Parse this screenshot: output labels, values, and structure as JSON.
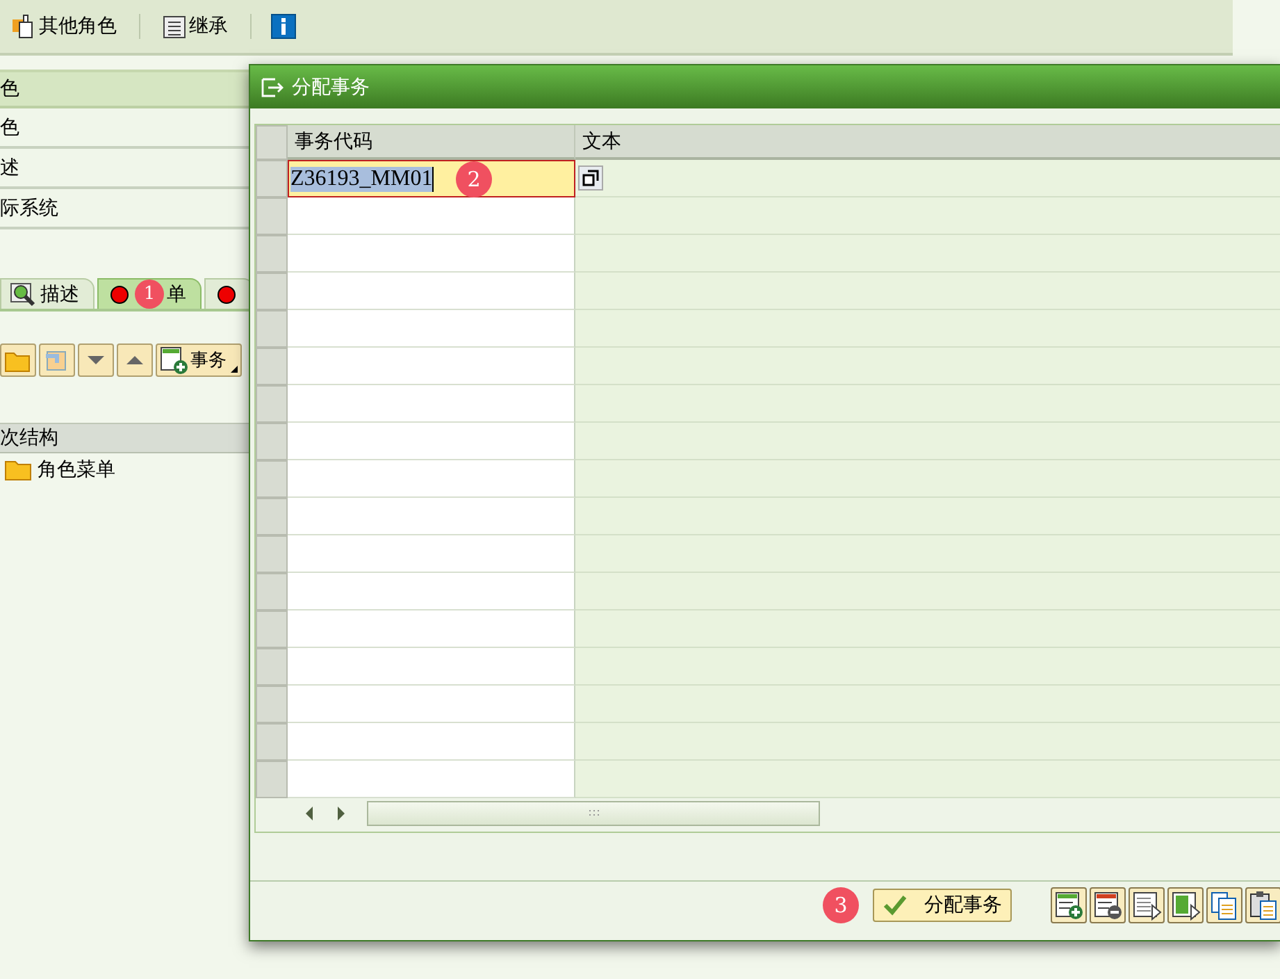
{
  "toolbar": {
    "items": [
      {
        "kind": "roles",
        "label": "其他角色"
      },
      {
        "kind": "inherit",
        "label": "继承"
      },
      {
        "kind": "info"
      }
    ]
  },
  "form": {
    "header": "色",
    "rows": [
      "色",
      "述",
      "际系统"
    ]
  },
  "tabs": [
    {
      "kind": "describe",
      "label": "描述",
      "selected": false
    },
    {
      "kind": "menu",
      "label": "单",
      "selected": true,
      "badge": "1"
    },
    {
      "kind": "menu",
      "selected": false
    }
  ],
  "menu_toolbar": {
    "buttons": [
      {
        "kind": "folder"
      },
      {
        "kind": "undo"
      },
      {
        "kind": "down"
      },
      {
        "kind": "up"
      },
      {
        "kind": "add",
        "label": "事务"
      }
    ]
  },
  "hierarchy": {
    "header": "次结构",
    "tree": [
      {
        "label": "角色菜单"
      }
    ]
  },
  "dialog": {
    "title": "分配事务",
    "table": {
      "columns": [
        "事务代码",
        "文本"
      ],
      "rows": [
        {
          "code": "Z36193_MM01",
          "text_selected": true,
          "badge": "2"
        }
      ]
    },
    "footer": {
      "badge": "3",
      "confirm": "分配事务",
      "tools": [
        {
          "kind": "insert"
        },
        {
          "kind": "delete"
        },
        {
          "kind": "select-all"
        },
        {
          "kind": "select-block"
        },
        {
          "kind": "copy"
        },
        {
          "kind": "paste"
        }
      ]
    }
  }
}
